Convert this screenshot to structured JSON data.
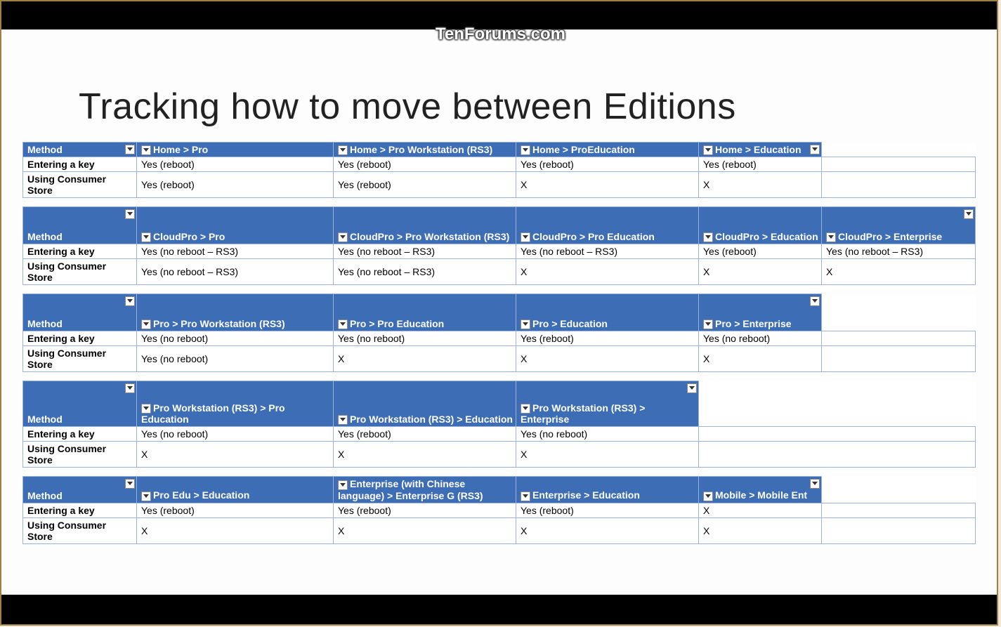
{
  "watermark": "TenForums.com",
  "title": "Tracking how to move between Editions",
  "row_labels": {
    "method": "Method",
    "r1": "Entering a key",
    "r2": "Using Consumer Store"
  },
  "t1": {
    "h1": "Home > Pro",
    "h2": "Home > Pro Workstation (RS3)",
    "h3": "Home > ProEducation",
    "h4": "Home > Education",
    "r1c1": "Yes (reboot)",
    "r1c2": "Yes (reboot)",
    "r1c3": "Yes (reboot)",
    "r1c4": "Yes (reboot)",
    "r2c1": "Yes (reboot)",
    "r2c2": "Yes (reboot)",
    "r2c3": "X",
    "r2c4": "X"
  },
  "t2": {
    "h1": "CloudPro > Pro",
    "h2": "CloudPro > Pro Workstation (RS3)",
    "h3": "CloudPro > Pro Education",
    "h4": "CloudPro > Education",
    "h5": "CloudPro > Enterprise",
    "r1c1": "Yes (no reboot – RS3)",
    "r1c2": "Yes (no reboot – RS3)",
    "r1c3": "Yes (no reboot – RS3)",
    "r1c4": "Yes (reboot)",
    "r1c5": "Yes (no reboot – RS3)",
    "r2c1": "Yes (no reboot – RS3)",
    "r2c2": "Yes (no reboot – RS3)",
    "r2c3": "X",
    "r2c4": "X",
    "r2c5": "X"
  },
  "t3": {
    "h1": "Pro > Pro Workstation (RS3)",
    "h2": "Pro > Pro Education",
    "h3": "Pro > Education",
    "h4": "Pro > Enterprise",
    "r1c1": "Yes (no reboot)",
    "r1c2": "Yes (no reboot)",
    "r1c3": "Yes (reboot)",
    "r1c4": "Yes (no reboot)",
    "r2c1": "Yes (no reboot)",
    "r2c2": "X",
    "r2c3": "X",
    "r2c4": "X"
  },
  "t4": {
    "h1": "Pro Workstation (RS3) > Pro Education",
    "h2": "Pro Workstation (RS3) > Education",
    "h3": "Pro Workstation (RS3) > Enterprise",
    "r1c1": "Yes (no reboot)",
    "r1c2": "Yes (reboot)",
    "r1c3": "Yes (no reboot)",
    "r2c1": "X",
    "r2c2": "X",
    "r2c3": "X"
  },
  "t5": {
    "h1": "Pro Edu > Education",
    "h2": "Enterprise (with Chinese language) > Enterprise G (RS3)",
    "h3": "Enterprise > Education",
    "h4": "Mobile > Mobile Ent",
    "r1c1": "Yes (reboot)",
    "r1c2": "Yes (reboot)",
    "r1c3": "Yes (reboot)",
    "r1c4": "X",
    "r2c1": "X",
    "r2c2": "X",
    "r2c3": "X",
    "r2c4": "X"
  }
}
